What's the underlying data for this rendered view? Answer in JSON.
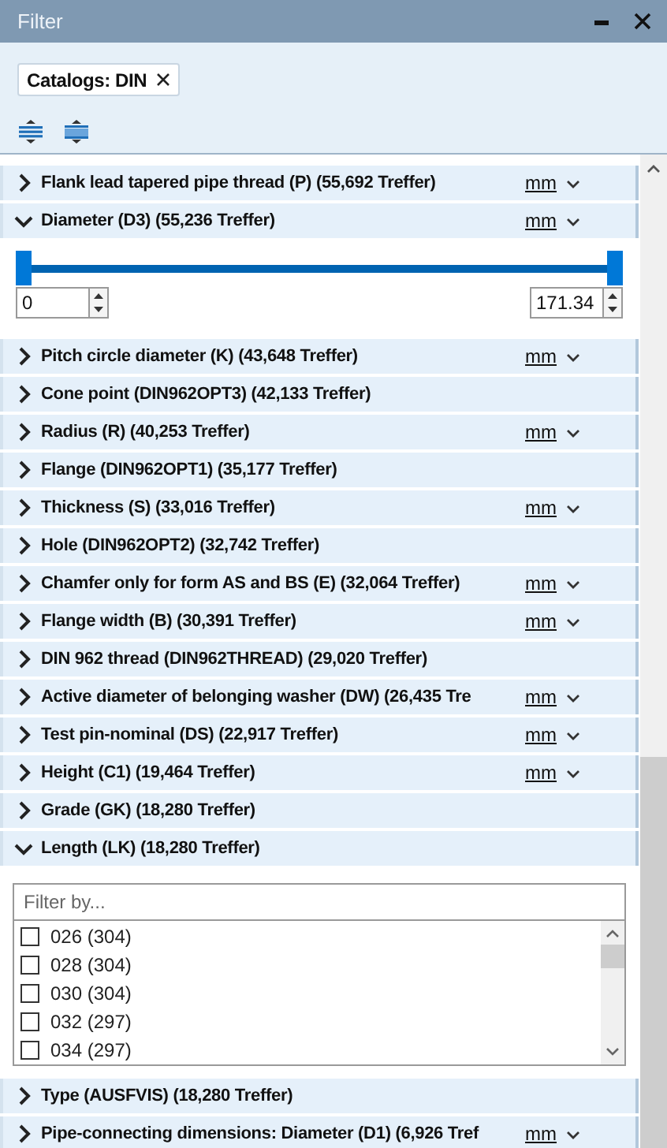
{
  "window": {
    "title": "Filter"
  },
  "active_filters": [
    {
      "label": "Catalogs: DIN"
    }
  ],
  "filters": [
    {
      "label": "Flank lead tapered pipe thread (P) (55,692 Treffer)",
      "unit": "mm",
      "expanded": false
    },
    {
      "label": "Diameter (D3) (55,236 Treffer)",
      "unit": "mm",
      "expanded": true,
      "panel": {
        "kind": "range",
        "thumbs": [
          {
            "level": 0
          },
          {
            "level": 1
          }
        ],
        "min_value": "0",
        "max_value": "171.34"
      }
    },
    {
      "label": "Pitch circle diameter (K) (43,648 Treffer)",
      "unit": "mm",
      "expanded": false
    },
    {
      "label": "Cone point (DIN962OPT3) (42,133 Treffer)",
      "expanded": false
    },
    {
      "label": "Radius (R) (40,253 Treffer)",
      "unit": "mm",
      "expanded": false
    },
    {
      "label": "Flange (DIN962OPT1) (35,177 Treffer)",
      "expanded": false
    },
    {
      "label": "Thickness (S) (33,016 Treffer)",
      "unit": "mm",
      "expanded": false
    },
    {
      "label": "Hole (DIN962OPT2) (32,742 Treffer)",
      "expanded": false
    },
    {
      "label": "Chamfer only for form AS and BS (E) (32,064 Treffer)",
      "unit": "mm",
      "expanded": false
    },
    {
      "label": "Flange width (B) (30,391 Treffer)",
      "unit": "mm",
      "expanded": false
    },
    {
      "label": "DIN 962 thread (DIN962THREAD) (29,020 Treffer)",
      "expanded": false
    },
    {
      "label": "Active diameter of belonging washer (DW) (26,435 Tre",
      "unit": "mm",
      "expanded": false
    },
    {
      "label": "Test pin-nominal (DS) (22,917 Treffer)",
      "unit": "mm",
      "expanded": false
    },
    {
      "label": "Height (C1) (19,464 Treffer)",
      "unit": "mm",
      "expanded": false
    },
    {
      "label": "Grade (GK) (18,280 Treffer)",
      "expanded": false
    },
    {
      "label": "Length (LK) (18,280 Treffer)",
      "expanded": true,
      "panel": {
        "kind": "list",
        "placeholder": "Filter by...",
        "options": [
          {
            "label": "026 (304)",
            "checked": false
          },
          {
            "label": "028 (304)",
            "checked": false
          },
          {
            "label": "030 (304)",
            "checked": false
          },
          {
            "label": "032 (297)",
            "checked": false
          },
          {
            "label": "034 (297)",
            "checked": false
          }
        ]
      }
    },
    {
      "label": "Type (AUSFVIS) (18,280 Treffer)",
      "expanded": false
    },
    {
      "label": "Pipe-connecting dimensions: Diameter (D1) (6,926 Tref",
      "unit": "mm",
      "expanded": false
    }
  ]
}
